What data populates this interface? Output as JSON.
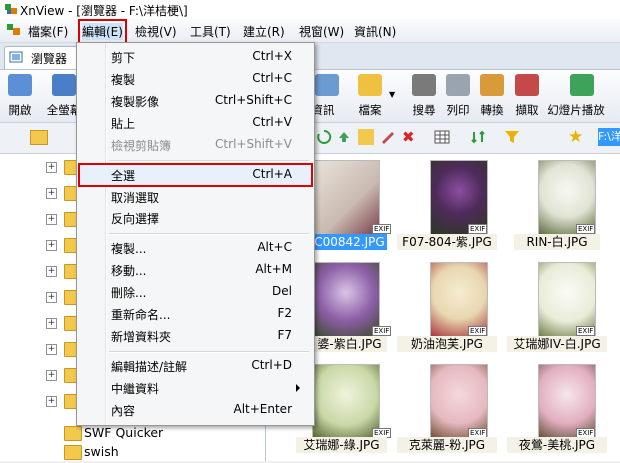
{
  "window": {
    "title": "XnView - [瀏覽器 - F:\\洋桔梗\\]"
  },
  "menubar": {
    "items": [
      "檔案(F)",
      "編輯(E)",
      "檢視(V)",
      "工具(T)",
      "建立(R)",
      "視窗(W)",
      "資訊(N)"
    ]
  },
  "tabs": {
    "browser": "瀏覽器"
  },
  "toolbar": {
    "left": [
      "開啟",
      "全螢幕"
    ],
    "right": [
      "資訊",
      "檔案",
      "搜尋",
      "列印",
      "轉換",
      "擷取",
      "幻燈片播放"
    ]
  },
  "address": {
    "path": "F:\\洋"
  },
  "tree": {
    "folders": [
      "SWF Quicker",
      "swish"
    ]
  },
  "thumbnails": [
    {
      "label": "C00842.JPG",
      "selected": true
    },
    {
      "label": "F07-804-紫.JPG",
      "selected": false
    },
    {
      "label": "RIN-白.JPG",
      "selected": false
    },
    {
      "label": "婆-紫白.JPG",
      "selected": false
    },
    {
      "label": "奶油泡芙.JPG",
      "selected": false
    },
    {
      "label": "艾瑞娜IV-白.JPG",
      "selected": false
    },
    {
      "label": "艾瑞娜-綠.JPG",
      "selected": false
    },
    {
      "label": "克萊麗-粉.JPG",
      "selected": false
    },
    {
      "label": "夜鶯-美桃.JPG",
      "selected": false
    }
  ],
  "badge": "EXIF",
  "edit_menu": {
    "items": [
      {
        "label": "剪下",
        "shortcut": "Ctrl+X"
      },
      {
        "label": "複製",
        "shortcut": "Ctrl+C"
      },
      {
        "label": "複製影像",
        "shortcut": "Ctrl+Shift+C"
      },
      {
        "label": "貼上",
        "shortcut": "Ctrl+V"
      },
      {
        "label": "檢視剪貼簿",
        "shortcut": "Ctrl+Shift+V"
      },
      {
        "label": "全選",
        "shortcut": "Ctrl+A"
      },
      {
        "label": "取消選取",
        "shortcut": ""
      },
      {
        "label": "反向選擇",
        "shortcut": ""
      },
      {
        "label": "複製...",
        "shortcut": "Alt+C"
      },
      {
        "label": "移動...",
        "shortcut": "Alt+M"
      },
      {
        "label": "刪除...",
        "shortcut": "Del"
      },
      {
        "label": "重新命名...",
        "shortcut": "F2"
      },
      {
        "label": "新增資料夾",
        "shortcut": "F7"
      },
      {
        "label": "編輯描述/註解",
        "shortcut": "Ctrl+D"
      },
      {
        "label": "中繼資料",
        "shortcut": ""
      },
      {
        "label": "內容",
        "shortcut": "Alt+Enter"
      }
    ]
  },
  "colors": {
    "highlight_box": "#e00000",
    "selection": "#3399ff"
  }
}
